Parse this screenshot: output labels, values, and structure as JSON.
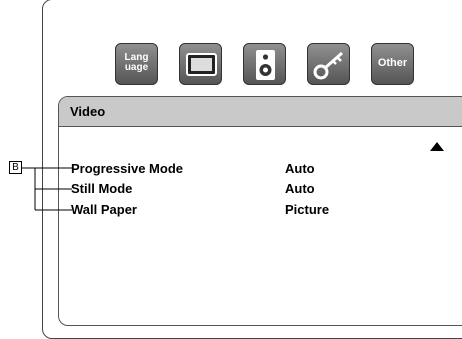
{
  "toolbar": {
    "items": [
      {
        "label": "Lang\nuage",
        "icon": "language-icon"
      },
      {
        "icon": "tv-screen-icon"
      },
      {
        "icon": "speaker-icon"
      },
      {
        "icon": "key-icon"
      },
      {
        "label": "Other",
        "icon": "other-icon"
      }
    ]
  },
  "panel": {
    "title": "Video",
    "settings": [
      {
        "label": "Progressive Mode",
        "value": "Auto"
      },
      {
        "label": "Still Mode",
        "value": "Auto"
      },
      {
        "label": "Wall Paper",
        "value": "Picture"
      }
    ]
  },
  "callout": {
    "label": "B"
  },
  "colors": {
    "header": "#c9c9c9",
    "icon": "#6e6e6e",
    "border": "#444444"
  }
}
